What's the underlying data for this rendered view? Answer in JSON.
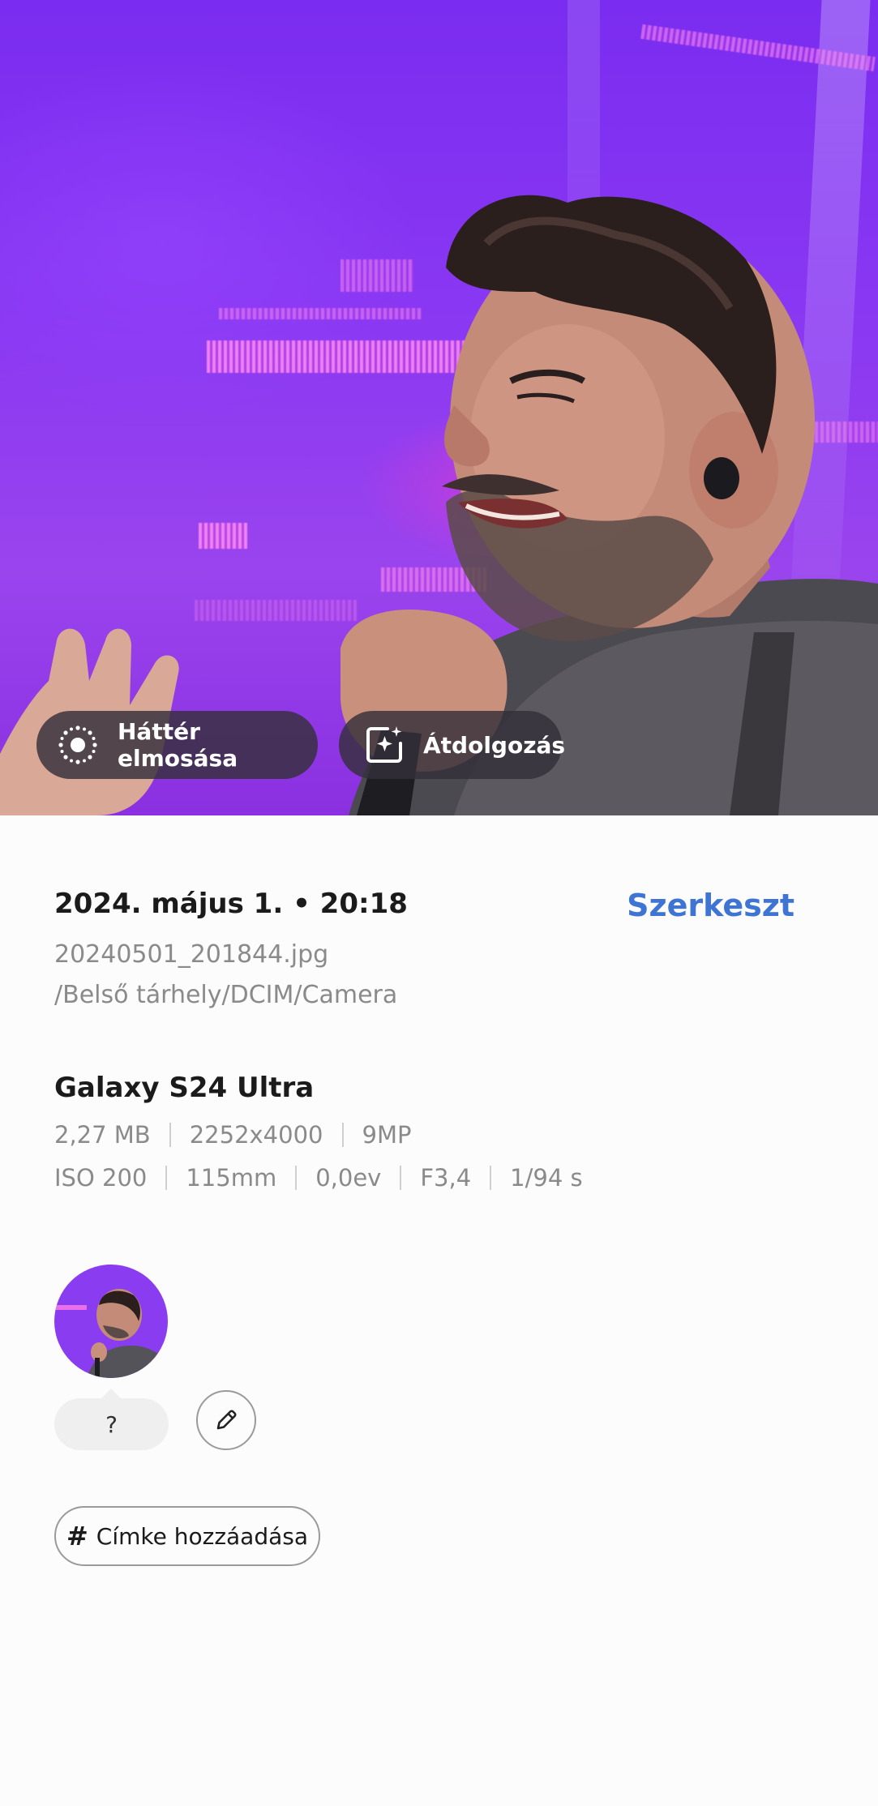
{
  "photo": {
    "chips": {
      "blur_label": "Háttér elmosása",
      "remaster_label": "Átdolgozás"
    }
  },
  "details": {
    "date_time": "2024. május 1. • 20:18",
    "edit_label": "Szerkeszt",
    "file_name": "20240501_201844.jpg",
    "file_path": "/Belső tárhely/DCIM/Camera",
    "device": "Galaxy S24 Ultra",
    "specs_row1": [
      "2,27 MB",
      "2252x4000",
      "9MP"
    ],
    "specs_row2": [
      "ISO 200",
      "115mm",
      "0,0ev",
      "F3,4",
      "1/94 s"
    ]
  },
  "people": {
    "unknown_label": "?"
  },
  "tags": {
    "add_label": "Címke hozzáadása"
  },
  "colors": {
    "accent": "#3e74d4",
    "stage": "#8a38f2",
    "chip_bg": "#34303a"
  }
}
